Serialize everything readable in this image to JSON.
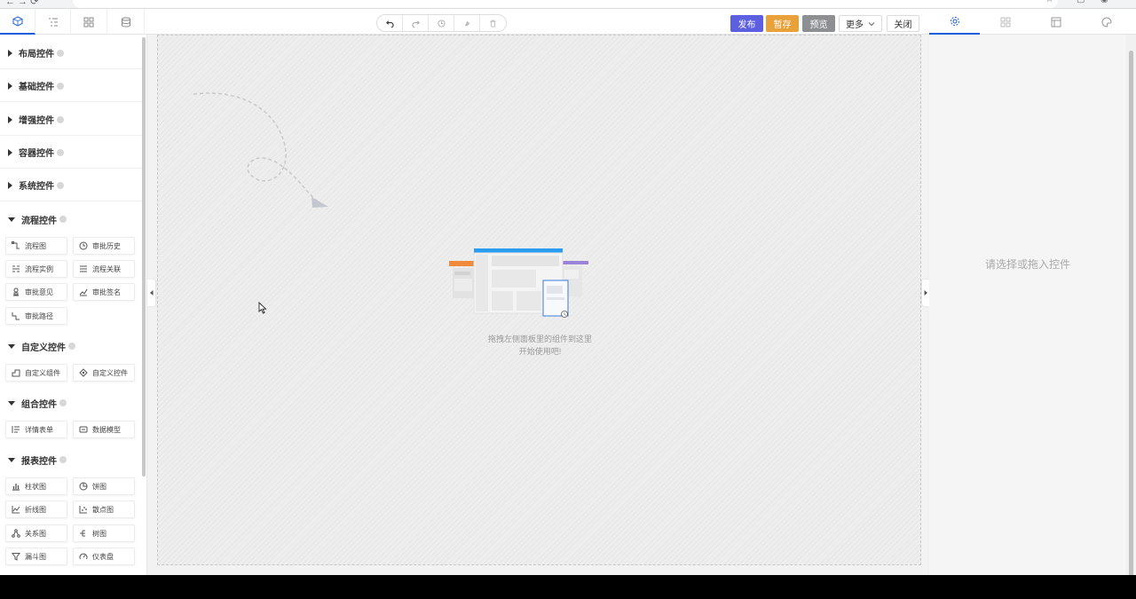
{
  "toolbar": {
    "history": [
      "undo",
      "redo",
      "history",
      "clear",
      "delete"
    ],
    "publish_label": "发布",
    "save_draft_label": "暂存",
    "preview_label": "预览",
    "more_label": "更多",
    "close_label": "关闭"
  },
  "sidebar": {
    "groups": [
      {
        "title": "布局控件",
        "expanded": false
      },
      {
        "title": "基础控件",
        "expanded": false
      },
      {
        "title": "增强控件",
        "expanded": false
      },
      {
        "title": "容器控件",
        "expanded": false
      },
      {
        "title": "系统控件",
        "expanded": false
      },
      {
        "title": "流程控件",
        "expanded": true
      },
      {
        "title": "自定义控件",
        "expanded": true
      },
      {
        "title": "组合控件",
        "expanded": true
      },
      {
        "title": "报表控件",
        "expanded": true
      }
    ],
    "flow_items": [
      "流程图",
      "审批历史",
      "流程实例",
      "流程关联",
      "审批意见",
      "审批签名",
      "审批路径"
    ],
    "custom_items": [
      "自定义组件",
      "自定义控件"
    ],
    "combo_items": [
      "详情表单",
      "数据模型"
    ],
    "report_items": [
      "柱状图",
      "饼图",
      "折线图",
      "散点图",
      "关系图",
      "树图",
      "漏斗图",
      "仪表盘"
    ]
  },
  "canvas": {
    "empty_line1": "拖拽左侧面板里的组件到这里",
    "empty_line2": "开始使用吧!"
  },
  "right_panel": {
    "placeholder": "请选择或拖入控件"
  },
  "colors": {
    "primary": "#5b5fe0",
    "warning": "#e9a23b",
    "gray": "#8d8f93",
    "active_tab": "#1a5fd8"
  }
}
